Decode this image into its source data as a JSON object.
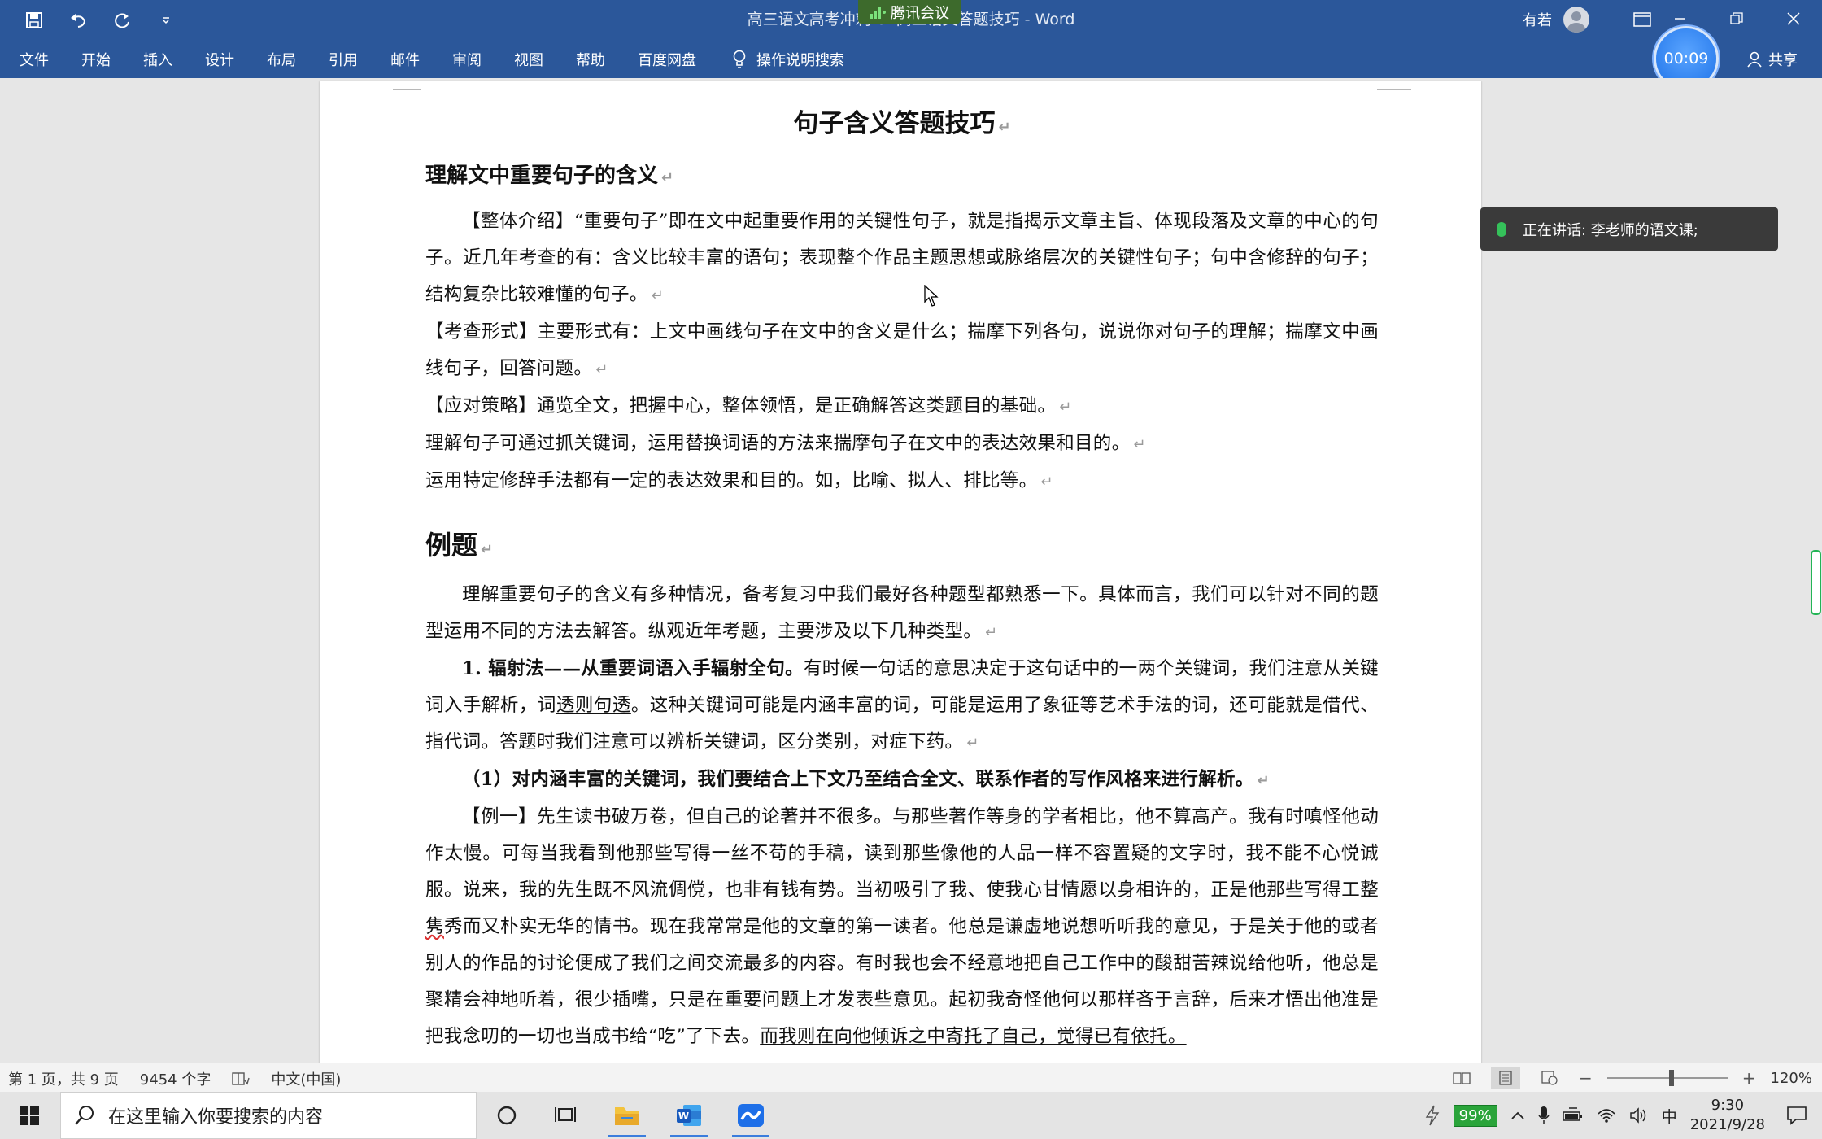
{
  "window": {
    "title": "高三语文高考冲刺-07高三语文答题技巧 - Word",
    "meeting_badge": "腾讯会议",
    "user_name": "有若",
    "timer": "00:09",
    "share_label": "共享"
  },
  "ribbon_tabs": [
    "文件",
    "开始",
    "插入",
    "设计",
    "布局",
    "引用",
    "邮件",
    "审阅",
    "视图",
    "帮助",
    "百度网盘"
  ],
  "tell_me": "操作说明搜索",
  "notification": {
    "text": "正在讲话: 李老师的语文课;"
  },
  "document": {
    "title": "句子含义答题技巧",
    "section1_heading": "理解文中重要句子的含义",
    "p1": "【整体介绍】“重要句子”即在文中起重要作用的关键性句子，就是指揭示文章主旨、体现段落及文章的中心的句子。近几年考查的有：含义比较丰富的语句；表现整个作品主题思想或脉络层次的关键性句子；句中含修辞的句子；结构复杂比较难懂的句子。",
    "p2": "【考查形式】主要形式有：上文中画线句子在文中的含义是什么；揣摩下列各句，说说你对句子的理解；揣摩文中画线句子，回答问题。",
    "p3": "【应对策略】通览全文，把握中心，整体领悟，是正确解答这类题目的基础。",
    "p4": "理解句子可通过抓关键词，运用替换词语的方法来揣摩句子在文中的表达效果和目的。",
    "p5": "运用特定修辞手法都有一定的表达效果和目的。如，比喻、拟人、排比等。",
    "section2_heading": "例题",
    "p6": "理解重要句子的含义有多种情况，备考复习中我们最好各种题型都熟悉一下。具体而言，我们可以针对不同的题型运用不同的方法去解答。纵观近年考题，主要涉及以下几种类型。",
    "p7_bold": "1. 辐射法——从重要词语入手辐射全句。",
    "p7_a": "有时候一句话的意思决定于这句话中的一两个关键词，我们注意从关键词入手解析，词",
    "p7_ul": "透则句透",
    "p7_b": "。这种关键词可能是内涵丰富的词，可能是运用了象征等艺术手法的词，还可能就是借代、指代词。答题时我们注意可以辨析关键词，区分类别，对症下药。",
    "p8": "（1）对内涵丰富的关键词，我们要结合上下文乃至结合全文、联系作者的写作风格来进行解析。",
    "p9_a": "【例一】先生读书破万卷，但自己的论著并不很多。与那些著作等身的学者相比，他不算高产。我有时嗔怪他动作太慢。可每当我看到他那些写得一丝不苟的手稿，读到那些像他的人品一样不容置疑的文字时，我不能不心悦诚服。说来，我的先生既不风流倜傥，也非有钱有势。当初吸引了我、使我心甘情愿以身相许的，正是他那些写得工整",
    "p9_sq": "隽",
    "p9_b": "秀而又朴实无华的情书。现在我常常是他的文章的第一读者。他总是谦虚地说想听听我的意见，于是关于他的或者别人的作品的讨论便成了我们之间交流最多的内容。有时我也会不经意地把自己工作中的酸甜苦辣说给他听，他总是聚精会神地听着，很少插嘴，只是在重要问题上才发表些意见。起初我奇怪他何以那样吝于言辞，后来才悟出他准是把我念叨的一切也当成书给“吃”了下去。",
    "p9_ul": "而我则在向他倾诉之中寄托了自己，觉得已有依托。"
  },
  "status": {
    "page": "第 1 页，共 9 页",
    "words": "9454 个字",
    "language": "中文(中国)",
    "zoom": "120%",
    "zoom_level_pct": 120
  },
  "taskbar": {
    "search_placeholder": "在这里输入你要搜索的内容",
    "battery": "99%",
    "ime": "中",
    "time": "9:30",
    "date": "2021/9/28"
  },
  "colors": {
    "word_blue": "#2b579a",
    "toast_bg": "#3a3a3a",
    "battery_green": "#2aa43a"
  },
  "icons": [
    "save-icon",
    "undo-icon",
    "redo-icon",
    "lightbulb-icon",
    "person-icon",
    "mic-icon",
    "windows-icon",
    "search-icon",
    "cortana-icon",
    "task-view-icon",
    "file-explorer-icon",
    "word-icon",
    "meeting-icon",
    "notification-icon"
  ]
}
